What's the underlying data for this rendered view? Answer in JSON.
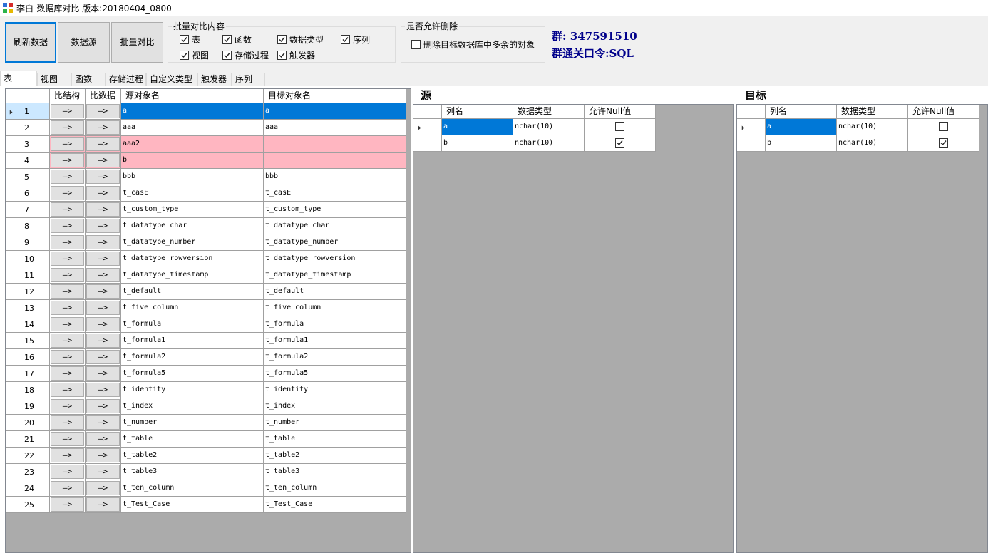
{
  "window": {
    "title": "李白-数据库对比 版本:20180404_0800"
  },
  "toolbar": {
    "refresh_label": "刷新数据",
    "datasource_label": "数据源",
    "batch_label": "批量对比"
  },
  "batch_group": {
    "title": "批量对比内容",
    "options": [
      {
        "label": "表",
        "checked": true
      },
      {
        "label": "函数",
        "checked": true
      },
      {
        "label": "数据类型",
        "checked": true
      },
      {
        "label": "序列",
        "checked": true
      },
      {
        "label": "视图",
        "checked": true
      },
      {
        "label": "存储过程",
        "checked": true
      },
      {
        "label": "触发器",
        "checked": true
      }
    ]
  },
  "delete_group": {
    "title": "是否允许删除",
    "option": {
      "label": "删除目标数据库中多余的对象",
      "checked": false
    }
  },
  "info": {
    "group_line": "群: 347591510",
    "password_line": "群通关口令:SQL"
  },
  "tabs": [
    "表",
    "视图",
    "函数",
    "存储过程",
    "自定义类型",
    "触发器",
    "序列"
  ],
  "main_grid": {
    "headers": [
      "比结构",
      "比数据",
      "源对象名",
      "目标对象名"
    ],
    "arrow": "—>",
    "rows": [
      {
        "n": "1",
        "src": "a",
        "dst": "a",
        "state": "selected"
      },
      {
        "n": "2",
        "src": "aaa",
        "dst": "aaa",
        "state": "normal"
      },
      {
        "n": "3",
        "src": "aaa2",
        "dst": "",
        "state": "missing"
      },
      {
        "n": "4",
        "src": "b",
        "dst": "",
        "state": "missing"
      },
      {
        "n": "5",
        "src": "bbb",
        "dst": "bbb",
        "state": "normal"
      },
      {
        "n": "6",
        "src": "t_casE",
        "dst": "t_casE",
        "state": "normal"
      },
      {
        "n": "7",
        "src": "t_custom_type",
        "dst": "t_custom_type",
        "state": "normal"
      },
      {
        "n": "8",
        "src": "t_datatype_char",
        "dst": "t_datatype_char",
        "state": "normal"
      },
      {
        "n": "9",
        "src": "t_datatype_number",
        "dst": "t_datatype_number",
        "state": "normal"
      },
      {
        "n": "10",
        "src": "t_datatype_rowversion",
        "dst": "t_datatype_rowversion",
        "state": "normal"
      },
      {
        "n": "11",
        "src": "t_datatype_timestamp",
        "dst": "t_datatype_timestamp",
        "state": "normal"
      },
      {
        "n": "12",
        "src": "t_default",
        "dst": "t_default",
        "state": "normal"
      },
      {
        "n": "13",
        "src": "t_five_column",
        "dst": "t_five_column",
        "state": "normal"
      },
      {
        "n": "14",
        "src": "t_formula",
        "dst": "t_formula",
        "state": "normal"
      },
      {
        "n": "15",
        "src": "t_formula1",
        "dst": "t_formula1",
        "state": "normal"
      },
      {
        "n": "16",
        "src": "t_formula2",
        "dst": "t_formula2",
        "state": "normal"
      },
      {
        "n": "17",
        "src": "t_formula5",
        "dst": "t_formula5",
        "state": "normal"
      },
      {
        "n": "18",
        "src": "t_identity",
        "dst": "t_identity",
        "state": "normal"
      },
      {
        "n": "19",
        "src": "t_index",
        "dst": "t_index",
        "state": "normal"
      },
      {
        "n": "20",
        "src": "t_number",
        "dst": "t_number",
        "state": "normal"
      },
      {
        "n": "21",
        "src": "t_table",
        "dst": "t_table",
        "state": "normal"
      },
      {
        "n": "22",
        "src": "t_table2",
        "dst": "t_table2",
        "state": "normal"
      },
      {
        "n": "23",
        "src": "t_table3",
        "dst": "t_table3",
        "state": "normal"
      },
      {
        "n": "24",
        "src": "t_ten_column",
        "dst": "t_ten_column",
        "state": "normal"
      },
      {
        "n": "25",
        "src": "t_Test_Case",
        "dst": "t_Test_Case",
        "state": "normal"
      }
    ]
  },
  "source_panel": {
    "title": "源",
    "headers": [
      "列名",
      "数据类型",
      "允许Null值"
    ],
    "rows": [
      {
        "name": "a",
        "type": "nchar(10)",
        "nullable": false
      },
      {
        "name": "b",
        "type": "nchar(10)",
        "nullable": true
      }
    ]
  },
  "target_panel": {
    "title": "目标",
    "headers": [
      "列名",
      "数据类型",
      "允许Null值"
    ],
    "rows": [
      {
        "name": "a",
        "type": "nchar(10)",
        "nullable": false
      },
      {
        "name": "b",
        "type": "nchar(10)",
        "nullable": true
      }
    ]
  },
  "colors": {
    "selected": "#0078d7",
    "selected_rowhead": "#cce8ff",
    "missing": "#ffb6c1",
    "grid_bg": "#ababab",
    "qq_text": "#00008b"
  }
}
